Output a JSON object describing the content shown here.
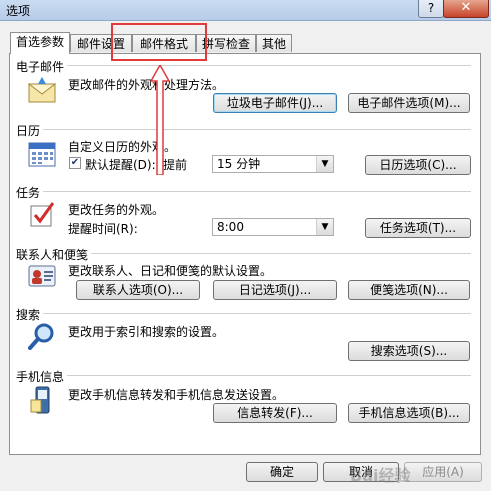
{
  "window": {
    "title": "选项",
    "help_label": "?",
    "close_label": "✕"
  },
  "tabs": [
    {
      "label": "首选参数"
    },
    {
      "label": "邮件设置"
    },
    {
      "label": "邮件格式"
    },
    {
      "label": "拼写检查"
    },
    {
      "label": "其他"
    }
  ],
  "sections": {
    "mail": {
      "label": "电子邮件",
      "description": "更改邮件的外观和处理方法。",
      "junk_button": "垃圾电子邮件(J)...",
      "options_button": "电子邮件选项(M)..."
    },
    "calendar": {
      "label": "日历",
      "description": "自定义日历的外观。",
      "reminder_label": "默认提醒(D):",
      "before_label": "提前",
      "reminder_value": "15 分钟",
      "options_button": "日历选项(C)..."
    },
    "tasks": {
      "label": "任务",
      "description": "更改任务的外观。",
      "reminder_time_label": "提醒时间(R):",
      "reminder_time_value": "8:00",
      "options_button": "任务选项(T)..."
    },
    "contacts": {
      "label": "联系人和便笺",
      "description": "更改联系人、日记和便笺的默认设置。",
      "contact_button": "联系人选项(O)...",
      "journal_button": "日记选项(J)...",
      "notes_button": "便笺选项(N)..."
    },
    "search": {
      "label": "搜索",
      "description": "更改用于索引和搜索的设置。",
      "options_button": "搜索选项(S)..."
    },
    "mobile": {
      "label": "手机信息",
      "description": "更改手机信息转发和手机信息发送设置。",
      "forward_button": "信息转发(F)...",
      "options_button": "手机信息选项(B)..."
    }
  },
  "footer": {
    "ok": "确定",
    "cancel": "取消",
    "apply": "应用(A)"
  },
  "watermark": "Bai经验"
}
